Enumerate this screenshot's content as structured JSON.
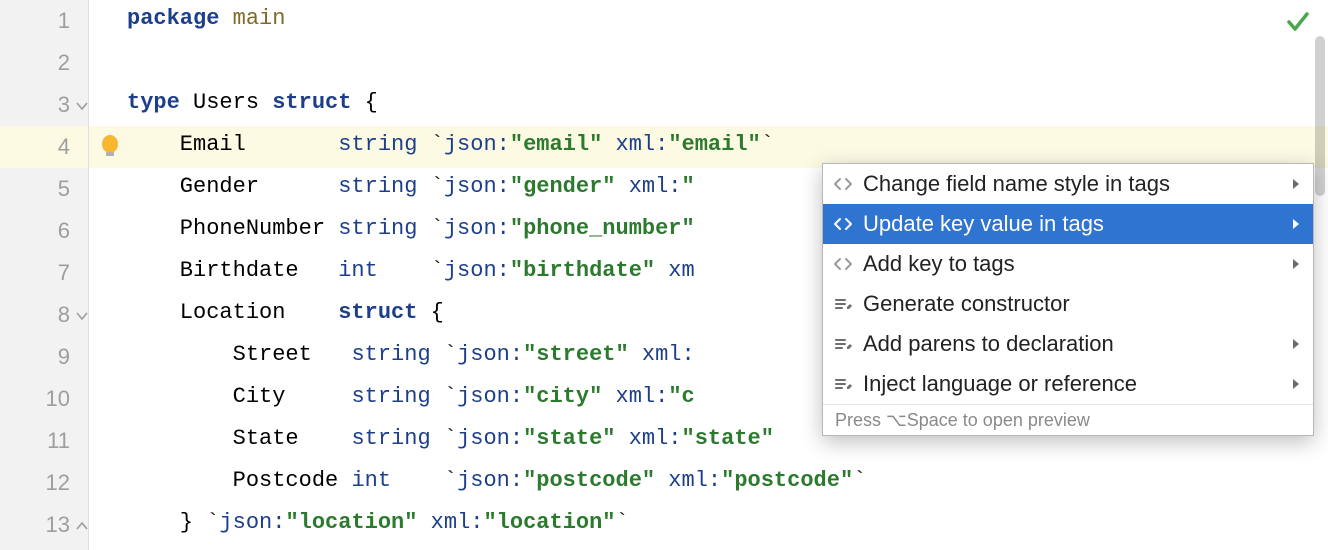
{
  "lines": [
    {
      "n": "1",
      "tokens": [
        {
          "t": "package ",
          "c": "kw"
        },
        {
          "t": "main",
          "c": "id"
        }
      ]
    },
    {
      "n": "2",
      "tokens": []
    },
    {
      "n": "3",
      "tokens": [
        {
          "t": "type ",
          "c": "kw"
        },
        {
          "t": "Users ",
          "c": ""
        },
        {
          "t": "struct",
          "c": "kw"
        },
        {
          "t": " {",
          "c": ""
        }
      ]
    },
    {
      "n": "4",
      "hl": true,
      "tokens": [
        {
          "t": "    Email       ",
          "c": ""
        },
        {
          "t": "string",
          "c": "typ"
        },
        {
          "t": " ",
          "c": ""
        },
        {
          "t": "`",
          "c": "tick"
        },
        {
          "t": "json:",
          "c": "tag"
        },
        {
          "t": "\"email\"",
          "c": "str"
        },
        {
          "t": " xml:",
          "c": "tag"
        },
        {
          "t": "\"email\"",
          "c": "str"
        },
        {
          "t": "`",
          "c": "tick"
        }
      ]
    },
    {
      "n": "5",
      "tokens": [
        {
          "t": "    Gender      ",
          "c": ""
        },
        {
          "t": "string",
          "c": "typ"
        },
        {
          "t": " ",
          "c": ""
        },
        {
          "t": "`",
          "c": "tick"
        },
        {
          "t": "json:",
          "c": "tag"
        },
        {
          "t": "\"gender\"",
          "c": "str"
        },
        {
          "t": " xml:",
          "c": "tag"
        },
        {
          "t": "\"",
          "c": "str"
        }
      ]
    },
    {
      "n": "6",
      "tokens": [
        {
          "t": "    PhoneNumber ",
          "c": ""
        },
        {
          "t": "string",
          "c": "typ"
        },
        {
          "t": " ",
          "c": ""
        },
        {
          "t": "`",
          "c": "tick"
        },
        {
          "t": "json:",
          "c": "tag"
        },
        {
          "t": "\"phone_number\"",
          "c": "str"
        }
      ]
    },
    {
      "n": "7",
      "tokens": [
        {
          "t": "    Birthdate   ",
          "c": ""
        },
        {
          "t": "int",
          "c": "typ"
        },
        {
          "t": "    ",
          "c": ""
        },
        {
          "t": "`",
          "c": "tick"
        },
        {
          "t": "json:",
          "c": "tag"
        },
        {
          "t": "\"birthdate\"",
          "c": "str"
        },
        {
          "t": " xm",
          "c": "tag"
        }
      ]
    },
    {
      "n": "8",
      "tokens": [
        {
          "t": "    Location    ",
          "c": ""
        },
        {
          "t": "struct",
          "c": "kw"
        },
        {
          "t": " {",
          "c": ""
        }
      ]
    },
    {
      "n": "9",
      "tokens": [
        {
          "t": "        Street   ",
          "c": ""
        },
        {
          "t": "string",
          "c": "typ"
        },
        {
          "t": " ",
          "c": ""
        },
        {
          "t": "`",
          "c": "tick"
        },
        {
          "t": "json:",
          "c": "tag"
        },
        {
          "t": "\"street\"",
          "c": "str"
        },
        {
          "t": " xml:",
          "c": "tag"
        }
      ]
    },
    {
      "n": "10",
      "tokens": [
        {
          "t": "        City     ",
          "c": ""
        },
        {
          "t": "string",
          "c": "typ"
        },
        {
          "t": " ",
          "c": ""
        },
        {
          "t": "`",
          "c": "tick"
        },
        {
          "t": "json:",
          "c": "tag"
        },
        {
          "t": "\"city\"",
          "c": "str"
        },
        {
          "t": " xml:",
          "c": "tag"
        },
        {
          "t": "\"c",
          "c": "str"
        }
      ]
    },
    {
      "n": "11",
      "tokens": [
        {
          "t": "        State    ",
          "c": ""
        },
        {
          "t": "string",
          "c": "typ"
        },
        {
          "t": " ",
          "c": ""
        },
        {
          "t": "`",
          "c": "tick"
        },
        {
          "t": "json:",
          "c": "tag"
        },
        {
          "t": "\"state\"",
          "c": "str"
        },
        {
          "t": " xml:",
          "c": "tag"
        },
        {
          "t": "\"state\"",
          "c": "str"
        }
      ]
    },
    {
      "n": "12",
      "tokens": [
        {
          "t": "        Postcode ",
          "c": ""
        },
        {
          "t": "int",
          "c": "typ"
        },
        {
          "t": "    ",
          "c": ""
        },
        {
          "t": "`",
          "c": "tick"
        },
        {
          "t": "json:",
          "c": "tag"
        },
        {
          "t": "\"postcode\"",
          "c": "str"
        },
        {
          "t": " xml:",
          "c": "tag"
        },
        {
          "t": "\"postcode\"",
          "c": "str"
        },
        {
          "t": "`",
          "c": "tick"
        }
      ]
    },
    {
      "n": "13",
      "tokens": [
        {
          "t": "    } ",
          "c": ""
        },
        {
          "t": "`",
          "c": "tick"
        },
        {
          "t": "json:",
          "c": "tag"
        },
        {
          "t": "\"location\"",
          "c": "str"
        },
        {
          "t": " xml:",
          "c": "tag"
        },
        {
          "t": "\"location\"",
          "c": "str"
        },
        {
          "t": "`",
          "c": "tick"
        }
      ]
    }
  ],
  "popup": {
    "items": [
      {
        "icon": "tag",
        "label": "Change field name style in tags",
        "arrow": true,
        "sel": false
      },
      {
        "icon": "tag",
        "label": "Update key value in tags",
        "arrow": true,
        "sel": true
      },
      {
        "icon": "tag",
        "label": "Add key to tags",
        "arrow": true,
        "sel": false
      },
      {
        "icon": "pencil",
        "label": "Generate constructor",
        "arrow": false,
        "sel": false
      },
      {
        "icon": "pencil",
        "label": "Add parens to declaration",
        "arrow": true,
        "sel": false
      },
      {
        "icon": "pencil",
        "label": "Inject language or reference",
        "arrow": true,
        "sel": false
      }
    ],
    "footer": "Press ⌥Space to open preview"
  },
  "icons": {
    "bulb": "bulb-icon",
    "check": "check-icon"
  }
}
